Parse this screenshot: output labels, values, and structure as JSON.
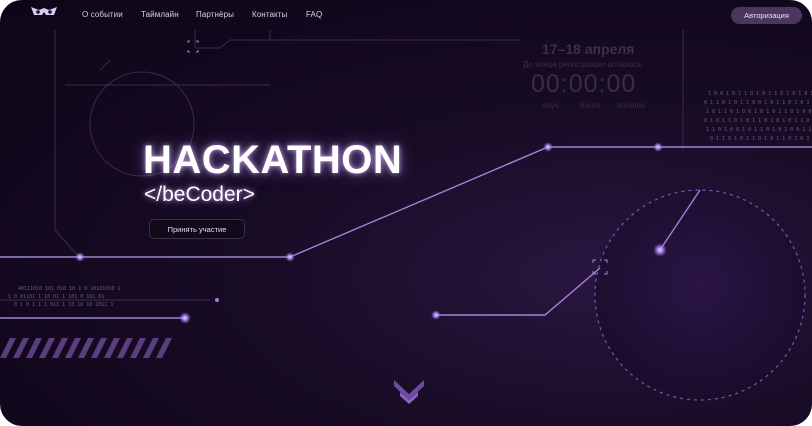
{
  "nav": {
    "links": [
      "О событии",
      "Таймлайн",
      "Партнёры",
      "Контакты",
      "FAQ"
    ],
    "auth_label": "Авторизация"
  },
  "hero": {
    "title": "HACKATHON",
    "subtitle": "</beCoder>",
    "cta_label": "Принять участие"
  },
  "countdown": {
    "date": "17–18 апреля",
    "label": "До конца регистрации осталось:",
    "timer": "00:00:00",
    "units": [
      "days",
      "hours",
      "minutes"
    ]
  },
  "binary_rows": {
    "left": [
      "40111010    101 010  10 1  0        10101010 1",
      "1  0    01101 1   10 01 1 101 0 101      01",
      "   0 1  0 1 1  1 011 1 10 10 10 1011 1"
    ]
  },
  "icons": {
    "logo": "owl-eyes-logo-icon",
    "scroll": "chevron-down-icon",
    "targets": "focus-bracket-icon"
  },
  "colors": {
    "background": "#12081d",
    "accent": "#a98bf0",
    "auth_button": "#4a3660",
    "glow": "#c8a8ff"
  }
}
